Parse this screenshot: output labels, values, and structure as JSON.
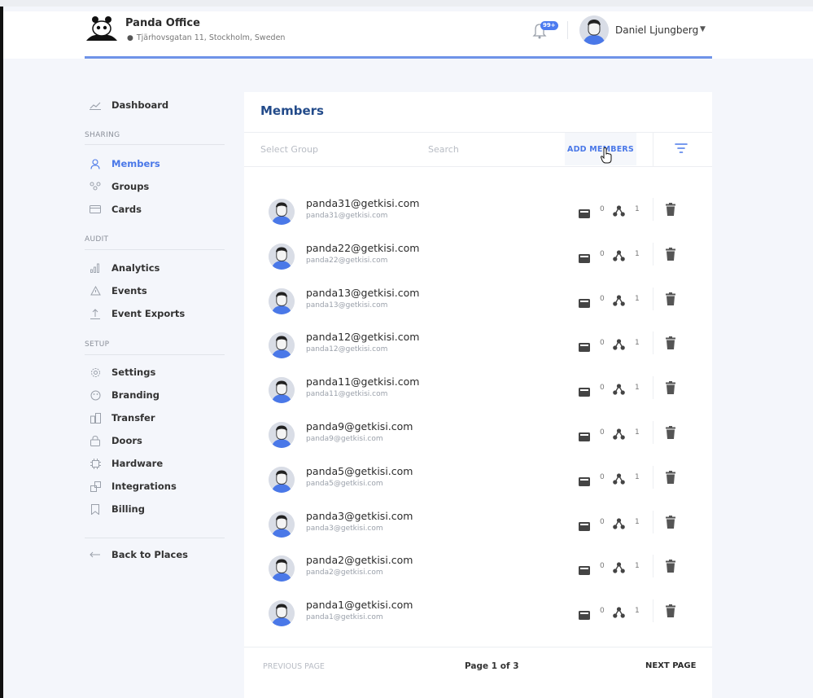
{
  "header": {
    "org_name": "Panda Office",
    "org_address": "Tjärhovsgatan 11, Stockholm, Sweden",
    "notification_badge": "99+",
    "user_name": "Daniel Ljungberg"
  },
  "sidebar": {
    "dashboard": "Dashboard",
    "sections": {
      "sharing": "SHARING",
      "audit": "AUDIT",
      "setup": "SETUP"
    },
    "items": {
      "members": "Members",
      "groups": "Groups",
      "cards": "Cards",
      "analytics": "Analytics",
      "events": "Events",
      "event_exports": "Event Exports",
      "settings": "Settings",
      "branding": "Branding",
      "transfer": "Transfer",
      "doors": "Doors",
      "hardware": "Hardware",
      "integrations": "Integrations",
      "billing": "Billing"
    },
    "back": "Back to Places",
    "active_item": "members"
  },
  "members": {
    "title": "Members",
    "select_group_placeholder": "Select Group",
    "search_placeholder": "Search",
    "add_button": "ADD MEMBERS",
    "rows": [
      {
        "name": "panda31@getkisi.com",
        "email": "panda31@getkisi.com",
        "cards": "0",
        "groups": "1"
      },
      {
        "name": "panda22@getkisi.com",
        "email": "panda22@getkisi.com",
        "cards": "0",
        "groups": "1"
      },
      {
        "name": "panda13@getkisi.com",
        "email": "panda13@getkisi.com",
        "cards": "0",
        "groups": "1"
      },
      {
        "name": "panda12@getkisi.com",
        "email": "panda12@getkisi.com",
        "cards": "0",
        "groups": "1"
      },
      {
        "name": "panda11@getkisi.com",
        "email": "panda11@getkisi.com",
        "cards": "0",
        "groups": "1"
      },
      {
        "name": "panda9@getkisi.com",
        "email": "panda9@getkisi.com",
        "cards": "0",
        "groups": "1"
      },
      {
        "name": "panda5@getkisi.com",
        "email": "panda5@getkisi.com",
        "cards": "0",
        "groups": "1"
      },
      {
        "name": "panda3@getkisi.com",
        "email": "panda3@getkisi.com",
        "cards": "0",
        "groups": "1"
      },
      {
        "name": "panda2@getkisi.com",
        "email": "panda2@getkisi.com",
        "cards": "0",
        "groups": "1"
      },
      {
        "name": "panda1@getkisi.com",
        "email": "panda1@getkisi.com",
        "cards": "0",
        "groups": "1"
      }
    ],
    "pagination": {
      "previous": "PREVIOUS PAGE",
      "page_info": "Page 1 of 3",
      "next": "NEXT PAGE"
    }
  },
  "colors": {
    "accent": "#4a78e8",
    "title": "#234b8a",
    "header_line": "#6f93e8"
  },
  "icons": {
    "logo": "panda-logo-icon",
    "bell": "bell-icon",
    "filter": "filter-icon",
    "card": "card-icon",
    "group": "group-icon",
    "trash": "trash-icon"
  }
}
